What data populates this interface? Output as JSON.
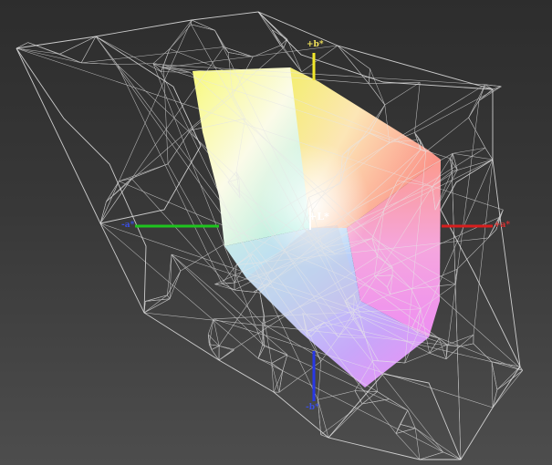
{
  "axes": {
    "a_plus": "+a*",
    "a_minus": "-a*",
    "b_plus": "+b*",
    "b_minus": "-b*",
    "l_plus": "+L*"
  },
  "colors": {
    "background_top": "#2d2d2d",
    "background_bottom": "#4d4d4d",
    "wireframe": "#e6e6e6",
    "axis_a_plus": "#d81e1e",
    "axis_a_minus": "#1ec41e",
    "axis_b_plus": "#f2e82a",
    "axis_b_minus": "#2838e6"
  },
  "icons": {
    "gamut_solid": "color-gamut-solid",
    "reference_wireframe": "reference-gamut-wireframe"
  }
}
